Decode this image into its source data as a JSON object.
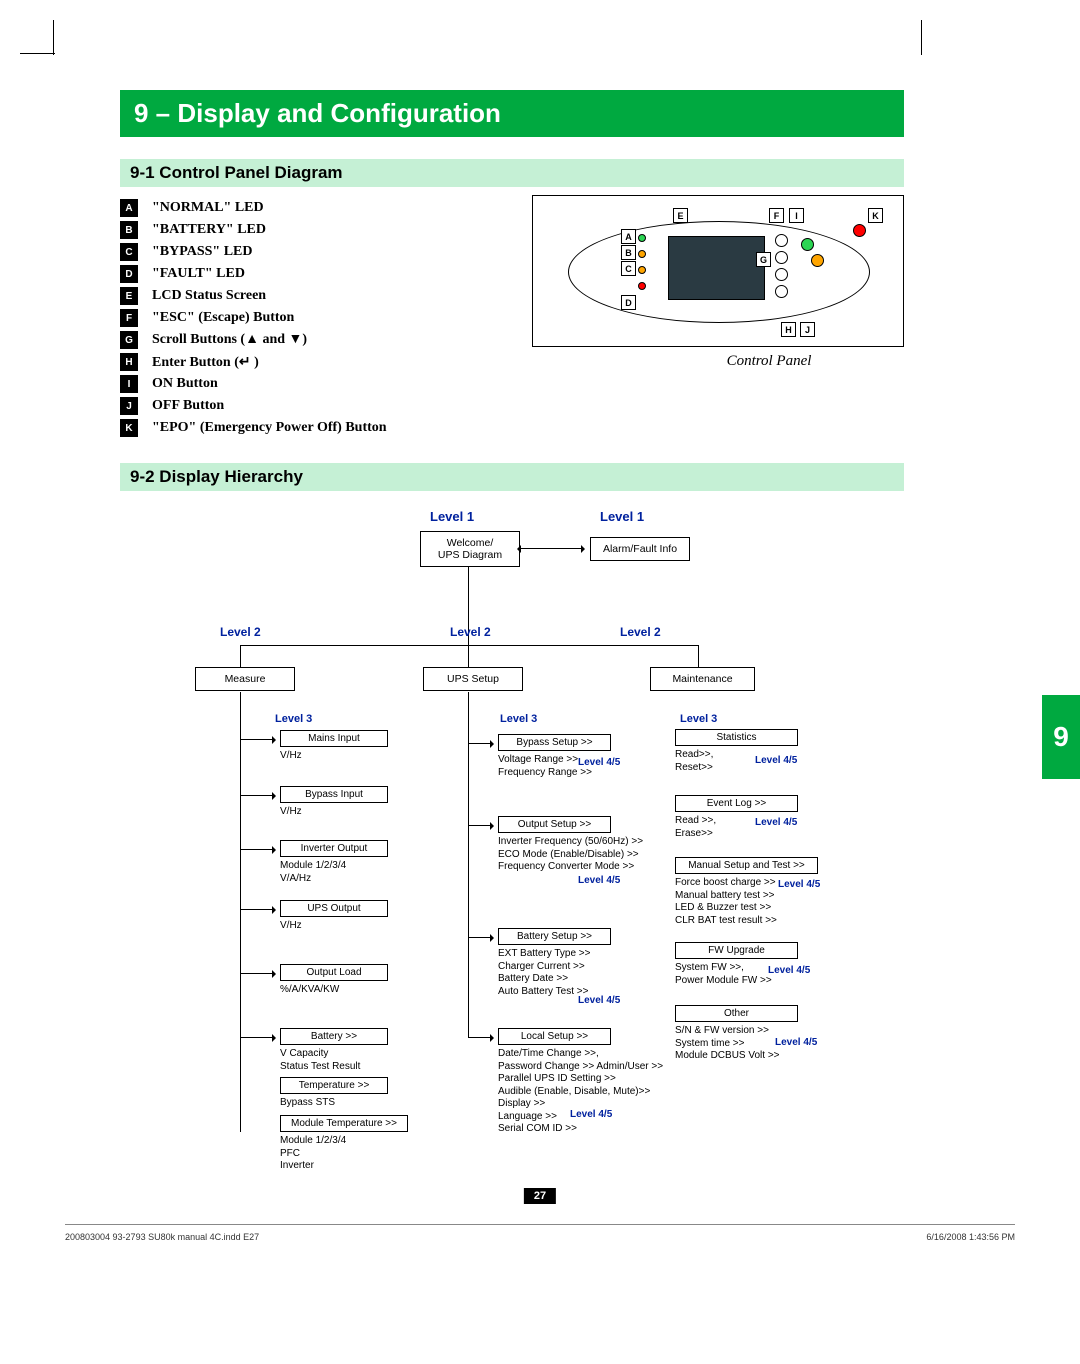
{
  "chapter": {
    "title": "9 – Display and Configuration",
    "sidetab": "9",
    "pagenum": "27"
  },
  "sec91": {
    "title": "9-1 Control Panel Diagram",
    "caption": "Control Panel",
    "items": [
      {
        "k": "A",
        "t": "\"NORMAL\" LED"
      },
      {
        "k": "B",
        "t": "\"BATTERY\" LED"
      },
      {
        "k": "C",
        "t": "\"BYPASS\" LED"
      },
      {
        "k": "D",
        "t": "\"FAULT\" LED"
      },
      {
        "k": "E",
        "t": "LCD Status Screen"
      },
      {
        "k": "F",
        "t": "\"ESC\" (Escape) Button"
      },
      {
        "k": "G",
        "t": "Scroll Buttons (▲ and ▼)"
      },
      {
        "k": "H",
        "t": "Enter Button (↵ )"
      },
      {
        "k": "I",
        "t": "ON Button"
      },
      {
        "k": "J",
        "t": "OFF Button"
      },
      {
        "k": "K",
        "t": "\"EPO\" (Emergency Power Off) Button"
      }
    ]
  },
  "sec92": {
    "title": "9-2 Display Hierarchy",
    "labels": {
      "l1": "Level 1",
      "l2": "Level  2",
      "l3": "Level 3",
      "l45": "Level 4/5"
    },
    "top": {
      "welcome": "Welcome/\nUPS Diagram",
      "alarm": "Alarm/Fault Info"
    },
    "l2": {
      "measure": "Measure",
      "ups": "UPS Setup",
      "maint": "Maintenance"
    },
    "measure": {
      "mains": {
        "h": "Mains Input",
        "s": "V/Hz"
      },
      "bypass": {
        "h": "Bypass Input",
        "s": "V/Hz"
      },
      "inv": {
        "h": "Inverter Output",
        "s": "Module 1/2/3/4\nV/A/Hz"
      },
      "upsout": {
        "h": "UPS Output",
        "s": "V/Hz"
      },
      "load": {
        "h": "Output Load",
        "s": "%/A/KVA/KW"
      },
      "bat": {
        "h": "Battery >>",
        "s": "V              Capacity\nStatus      Test Result"
      },
      "temp": {
        "h": "Temperature >>",
        "s": "Bypass STS"
      },
      "mtemp": {
        "h": "Module Temperature >>",
        "s": "Module 1/2/3/4\n  PFC\n  Inverter"
      }
    },
    "ups": {
      "byp": {
        "h": "Bypass Setup   >>",
        "s": "Voltage Range >>\nFrequency Range >>"
      },
      "out": {
        "h": "Output Setup   >>",
        "s": "Inverter Frequency (50/60Hz) >>\nECO Mode (Enable/Disable) >>\nFrequency Converter Mode  >>"
      },
      "batset": {
        "h": "Battery Setup   >>",
        "s": "EXT Battery Type >>\nCharger Current >>\nBattery Date >>\nAuto Battery Test >>"
      },
      "local": {
        "h": "Local Setup   >>",
        "s": "Date/Time Change >>,\nPassword Change >> Admin/User >>\nParallel UPS ID Setting  >>\nAudible (Enable, Disable, Mute)>>\nDisplay >>\nLanguage >>\nSerial COM ID >>"
      }
    },
    "maint": {
      "stat": {
        "h": "Statistics",
        "s": "Read>>,\nReset>>"
      },
      "evt": {
        "h": "Event Log >>",
        "s": "Read >>,\nErase>>"
      },
      "man": {
        "h": "Manual Setup and Test >>",
        "s": "Force boost charge >>\nManual battery test >>\nLED & Buzzer test >>\nCLR BAT test result  >>"
      },
      "fw": {
        "h": "FW Upgrade",
        "s": "System FW >>,\nPower Module FW  >>"
      },
      "oth": {
        "h": "Other",
        "s": "S/N & FW version >>\nSystem time >>\nModule DCBUS Volt  >>"
      }
    }
  },
  "footer": {
    "left": "200803004 93-2793 SU80k manual 4C.indd   E27",
    "right": "6/16/2008   1:43:56 PM"
  }
}
